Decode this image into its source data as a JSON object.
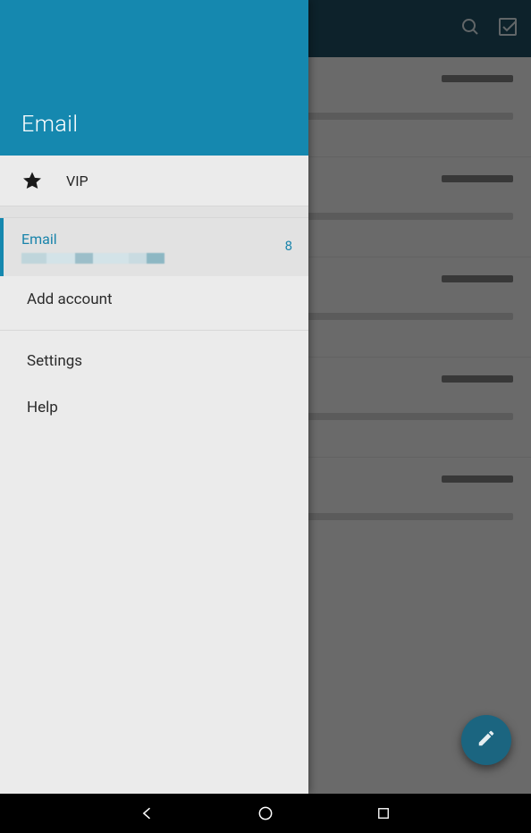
{
  "drawer": {
    "title": "Email",
    "vip_label": "VIP",
    "account": {
      "name": "Email",
      "unread_count": "8"
    },
    "add_account_label": "Add account",
    "settings_label": "Settings",
    "help_label": "Help"
  },
  "fab": {
    "icon_name": "compose-icon"
  },
  "topbar": {
    "search_icon": "search-icon",
    "select_icon": "checkbox-icon"
  },
  "nav": {
    "back": "back",
    "home": "home",
    "recents": "recents"
  }
}
